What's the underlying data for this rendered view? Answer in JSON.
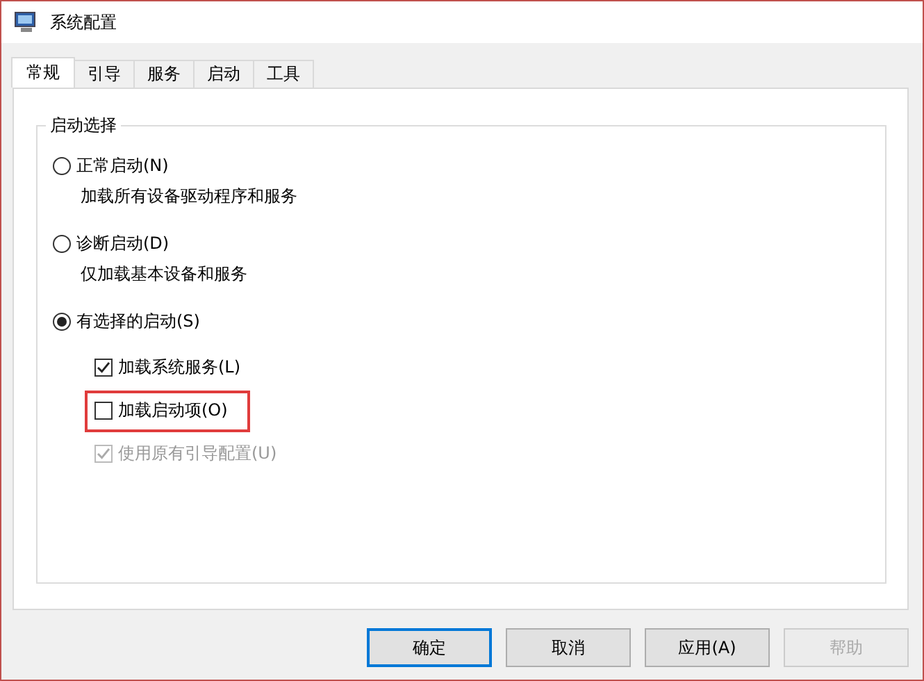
{
  "window": {
    "title": "系统配置"
  },
  "tabs": [
    {
      "label": "常规",
      "selected": true
    },
    {
      "label": "引导",
      "selected": false
    },
    {
      "label": "服务",
      "selected": false
    },
    {
      "label": "启动",
      "selected": false
    },
    {
      "label": "工具",
      "selected": false
    }
  ],
  "group": {
    "title": "启动选择",
    "options": [
      {
        "kind": "radio",
        "label": "正常启动(N)",
        "description": "加载所有设备驱动程序和服务",
        "selected": false
      },
      {
        "kind": "radio",
        "label": "诊断启动(D)",
        "description": "仅加载基本设备和服务",
        "selected": false
      },
      {
        "kind": "radio",
        "label": "有选择的启动(S)",
        "selected": true,
        "children": [
          {
            "kind": "checkbox",
            "label": "加载系统服务(L)",
            "checked": true,
            "disabled": false,
            "highlighted": false
          },
          {
            "kind": "checkbox",
            "label": "加载启动项(O)",
            "checked": false,
            "disabled": false,
            "highlighted": true
          },
          {
            "kind": "checkbox",
            "label": "使用原有引导配置(U)",
            "checked": true,
            "disabled": true,
            "highlighted": false
          }
        ]
      }
    ]
  },
  "buttons": [
    {
      "label": "确定",
      "default": true,
      "disabled": false
    },
    {
      "label": "取消",
      "default": false,
      "disabled": false
    },
    {
      "label": "应用(A)",
      "default": false,
      "disabled": false
    },
    {
      "label": "帮助",
      "default": false,
      "disabled": true
    }
  ]
}
